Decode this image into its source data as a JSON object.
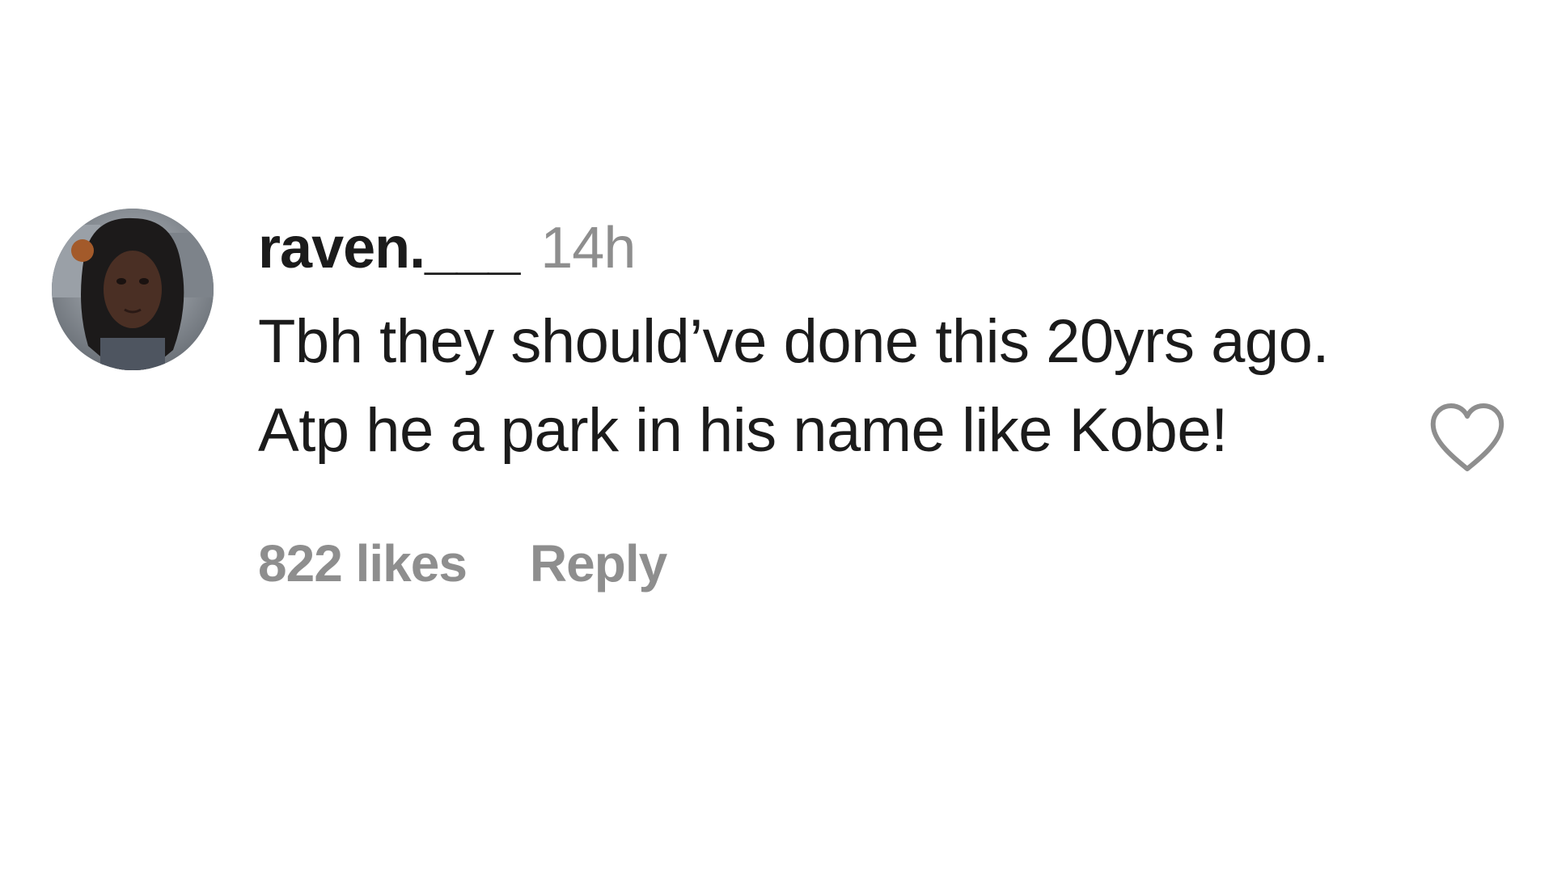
{
  "comment": {
    "username": "raven.___",
    "timestamp": "14h",
    "text": "Tbh they should’ve done this 20yrs ago. Atp he a park in his name like Kobe!",
    "likes_label": "822 likes",
    "reply_label": "Reply",
    "like_icon": "heart-outline-icon",
    "colors": {
      "text": "#1b1b1b",
      "muted": "#8e8e8e",
      "background": "#ffffff"
    }
  }
}
